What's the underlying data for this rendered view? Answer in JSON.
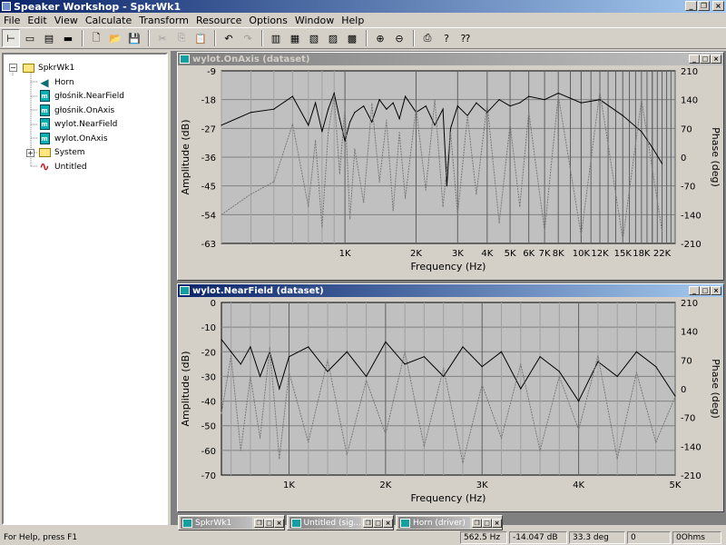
{
  "window": {
    "title": "Speaker Workshop - SpkrWk1"
  },
  "menu": [
    "File",
    "Edit",
    "View",
    "Calculate",
    "Transform",
    "Resource",
    "Options",
    "Window",
    "Help"
  ],
  "tree": {
    "root": "SpkrWk1",
    "items": [
      {
        "label": "Horn",
        "icon": "horn-driver-icon"
      },
      {
        "label": "głośnik.NearField",
        "icon": "dataset-icon"
      },
      {
        "label": "głośnik.OnAxis",
        "icon": "dataset-icon"
      },
      {
        "label": "wylot.NearField",
        "icon": "dataset-icon"
      },
      {
        "label": "wylot.OnAxis",
        "icon": "dataset-icon"
      },
      {
        "label": "System",
        "icon": "folder-icon",
        "expander": "+"
      },
      {
        "label": "Untitled",
        "icon": "signal-icon"
      }
    ]
  },
  "charts": {
    "top": {
      "title": "wylot.OnAxis (dataset)",
      "xlabel": "Frequency (Hz)",
      "ylabel": "Amplitude (dB)",
      "y2label": "Phase (deg)",
      "yticks": [
        "-9",
        "-18",
        "-27",
        "-36",
        "-45",
        "-54",
        "-63"
      ],
      "y2ticks": [
        "210",
        "140",
        "70",
        "0",
        "-70",
        "-140",
        "-210"
      ],
      "xticks": [
        "1K",
        "2K",
        "3K",
        "4K",
        "5K",
        "6K",
        "7K",
        "8K",
        "10K",
        "12K",
        "15K",
        "18K",
        "22K"
      ]
    },
    "bottom": {
      "title": "wylot.NearField (dataset)",
      "xlabel": "Frequency (Hz)",
      "ylabel": "Amplitude (dB)",
      "y2label": "Phase (deg)",
      "yticks": [
        "0",
        "-10",
        "-20",
        "-30",
        "-40",
        "-50",
        "-60",
        "-70"
      ],
      "y2ticks": [
        "210",
        "140",
        "70",
        "0",
        "-70",
        "-140",
        "-210"
      ],
      "xticks": [
        "1K",
        "2K",
        "3K",
        "4K",
        "5K"
      ]
    }
  },
  "chart_data": [
    {
      "type": "line",
      "title": "wylot.OnAxis (dataset)",
      "xlabel": "Frequency (Hz)",
      "ylabel": "Amplitude (dB)",
      "y2label": "Phase (deg)",
      "x_scale": "log",
      "ylim": [
        -63,
        -9
      ],
      "y2lim": [
        -210,
        210
      ],
      "grid": true,
      "series": [
        {
          "axis": "left",
          "style": "solid",
          "color": "#000000",
          "x": [
            300,
            400,
            500,
            600,
            700,
            750,
            800,
            850,
            900,
            950,
            1000,
            1050,
            1100,
            1200,
            1300,
            1400,
            1500,
            1600,
            1700,
            1800,
            2000,
            2200,
            2400,
            2600,
            2700,
            2800,
            3000,
            3300,
            3600,
            4000,
            4500,
            5000,
            5500,
            6000,
            7000,
            8000,
            10000,
            12000,
            15000,
            18000,
            20000,
            22000
          ],
          "y": [
            -26,
            -22,
            -21,
            -17,
            -26,
            -19,
            -28,
            -21,
            -16,
            -24,
            -31,
            -25,
            -22,
            -20,
            -25,
            -18,
            -21,
            -19,
            -24,
            -17,
            -22,
            -20,
            -26,
            -21,
            -45,
            -27,
            -20,
            -23,
            -19,
            -22,
            -18,
            -20,
            -19,
            -17,
            -18,
            -16,
            -19,
            -18,
            -23,
            -28,
            -33,
            -38
          ]
        },
        {
          "axis": "right",
          "style": "dotted",
          "color": "#7a7a7a",
          "x": [
            300,
            400,
            500,
            600,
            700,
            750,
            800,
            850,
            900,
            950,
            1000,
            1050,
            1100,
            1200,
            1300,
            1400,
            1500,
            1600,
            1700,
            1800,
            2000,
            2200,
            2400,
            2600,
            2800,
            3000,
            3300,
            3600,
            4000,
            4500,
            5000,
            5500,
            6000,
            7000,
            8000,
            10000,
            12000,
            15000,
            18000,
            22000
          ],
          "y": [
            -140,
            -90,
            -60,
            80,
            -120,
            40,
            -170,
            60,
            150,
            -40,
            120,
            -150,
            20,
            -110,
            130,
            -60,
            90,
            -130,
            60,
            -100,
            120,
            -80,
            140,
            -120,
            60,
            -140,
            100,
            -90,
            130,
            -160,
            80,
            -120,
            110,
            -180,
            150,
            -190,
            160,
            -200,
            140,
            -180
          ]
        }
      ]
    },
    {
      "type": "line",
      "title": "wylot.NearField (dataset)",
      "xlabel": "Frequency (Hz)",
      "ylabel": "Amplitude (dB)",
      "y2label": "Phase (deg)",
      "ylim": [
        -70,
        0
      ],
      "y2lim": [
        -210,
        210
      ],
      "grid": true,
      "series": [
        {
          "axis": "left",
          "style": "solid",
          "color": "#000000",
          "x": [
            300,
            400,
            500,
            600,
            700,
            800,
            900,
            1000,
            1200,
            1400,
            1600,
            1800,
            2000,
            2200,
            2400,
            2600,
            2800,
            3000,
            3200,
            3400,
            3600,
            3800,
            4000,
            4200,
            4400,
            4600,
            4800,
            5000
          ],
          "y": [
            -15,
            -20,
            -25,
            -18,
            -30,
            -20,
            -35,
            -22,
            -18,
            -28,
            -20,
            -30,
            -16,
            -25,
            -22,
            -30,
            -18,
            -26,
            -20,
            -35,
            -22,
            -28,
            -40,
            -24,
            -30,
            -20,
            -26,
            -38
          ]
        },
        {
          "axis": "right",
          "style": "dotted",
          "color": "#7a7a7a",
          "x": [
            300,
            400,
            500,
            600,
            700,
            800,
            900,
            1000,
            1200,
            1400,
            1600,
            1800,
            2000,
            2200,
            2400,
            2600,
            2800,
            3000,
            3200,
            3400,
            3600,
            3800,
            4000,
            4200,
            4400,
            4600,
            4800,
            5000
          ],
          "y": [
            -60,
            80,
            -150,
            30,
            -120,
            100,
            -170,
            40,
            -130,
            70,
            -160,
            20,
            -110,
            90,
            -140,
            50,
            -180,
            10,
            -120,
            60,
            -150,
            30,
            -100,
            80,
            -170,
            40,
            -130,
            -20
          ]
        }
      ]
    }
  ],
  "minimized": [
    {
      "label": "SpkrWk1"
    },
    {
      "label": "Untitled (sig..."
    },
    {
      "label": "Horn (driver)"
    }
  ],
  "status": {
    "help": "For Help, press F1",
    "freq": "562.5 Hz",
    "amp": "-14.047 dB",
    "phase": "33.3 deg",
    "f4": "0",
    "f5": "0Ohms"
  },
  "caption_buttons": {
    "min": "_",
    "max": "□",
    "close": "×"
  }
}
